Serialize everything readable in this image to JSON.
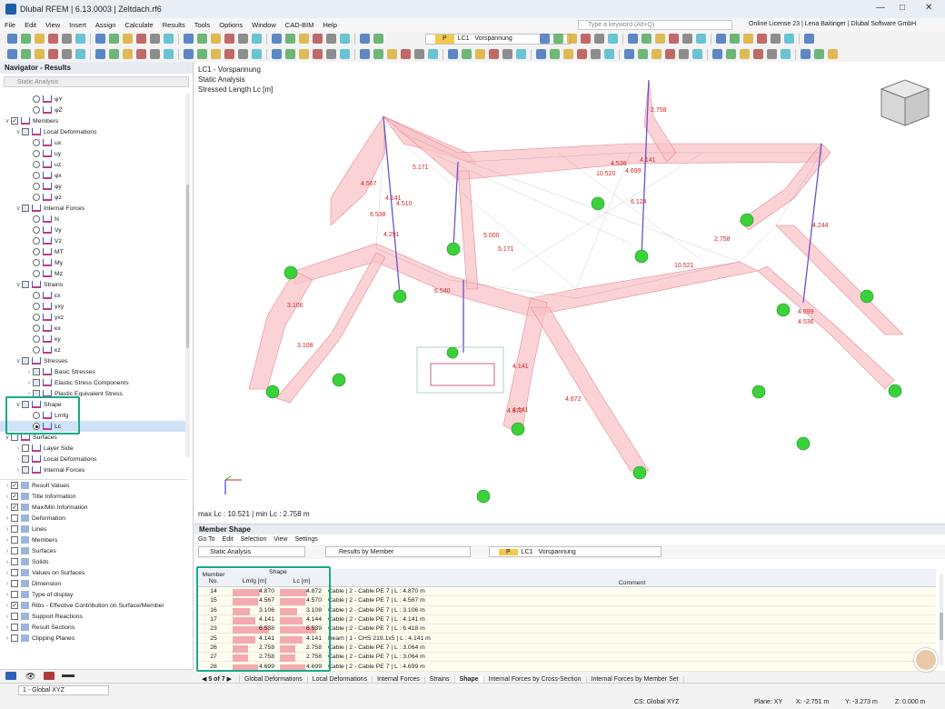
{
  "titlebar": {
    "title": "Dlubal RFEM | 6.13.0003 | Zeltdach.rf6"
  },
  "menu": [
    "File",
    "Edit",
    "View",
    "Insert",
    "Assign",
    "Calculate",
    "Results",
    "Tools",
    "Options",
    "Window",
    "CAD-BIM",
    "Help"
  ],
  "search": {
    "placeholder": "Type a keyword (Alt+Q)"
  },
  "license": "Online License 23 | Lena Baitinger | Dlubal Software GmbH",
  "toolbar": {
    "lc_tag": "P",
    "lc_id": "LC1",
    "lc_name": "Vorspannung"
  },
  "navigator": {
    "title": "Navigator - Results",
    "analysis": "Static Analysis",
    "items": [
      {
        "label": "φY",
        "level": 3,
        "ctl": "radio"
      },
      {
        "label": "φZ",
        "level": 3,
        "ctl": "radio"
      },
      {
        "label": "Members",
        "level": 1,
        "ctl": "check",
        "checked": true,
        "exp": "v"
      },
      {
        "label": "Local Deformations",
        "level": 2,
        "ctl": "box",
        "exp": "v"
      },
      {
        "label": "ux",
        "level": 3,
        "ctl": "radio"
      },
      {
        "label": "uy",
        "level": 3,
        "ctl": "radio"
      },
      {
        "label": "uz",
        "level": 3,
        "ctl": "radio"
      },
      {
        "label": "φx",
        "level": 3,
        "ctl": "radio"
      },
      {
        "label": "φy",
        "level": 3,
        "ctl": "radio"
      },
      {
        "label": "φz",
        "level": 3,
        "ctl": "radio"
      },
      {
        "label": "Internal Forces",
        "level": 2,
        "ctl": "box",
        "exp": "v"
      },
      {
        "label": "N",
        "level": 3,
        "ctl": "radio"
      },
      {
        "label": "Vy",
        "level": 3,
        "ctl": "radio"
      },
      {
        "label": "Vz",
        "level": 3,
        "ctl": "radio"
      },
      {
        "label": "MT",
        "level": 3,
        "ctl": "radio"
      },
      {
        "label": "My",
        "level": 3,
        "ctl": "radio"
      },
      {
        "label": "Mz",
        "level": 3,
        "ctl": "radio"
      },
      {
        "label": "Strains",
        "level": 2,
        "ctl": "box",
        "exp": "v"
      },
      {
        "label": "εx",
        "level": 3,
        "ctl": "radio"
      },
      {
        "label": "γxy",
        "level": 3,
        "ctl": "radio"
      },
      {
        "label": "γxz",
        "level": 3,
        "ctl": "radio"
      },
      {
        "label": "κx",
        "level": 3,
        "ctl": "radio"
      },
      {
        "label": "κy",
        "level": 3,
        "ctl": "radio"
      },
      {
        "label": "κz",
        "level": 3,
        "ctl": "radio"
      },
      {
        "label": "Stresses",
        "level": 2,
        "ctl": "box",
        "exp": "v"
      },
      {
        "label": "Basic Stresses",
        "level": 3,
        "ctl": "box",
        "exp": ">"
      },
      {
        "label": "Elastic Stress Components",
        "level": 3,
        "ctl": "box",
        "exp": ">"
      },
      {
        "label": "Plastic Equivalent Stress",
        "level": 3,
        "ctl": "box",
        "exp": ">"
      },
      {
        "label": "Shape",
        "level": 2,
        "ctl": "box",
        "exp": "v"
      },
      {
        "label": "Lmfg",
        "level": 3,
        "ctl": "radio"
      },
      {
        "label": "Lc",
        "level": 3,
        "ctl": "radio",
        "on": true,
        "sel": true
      },
      {
        "label": "Surfaces",
        "level": 1,
        "ctl": "check",
        "exp": "v"
      },
      {
        "label": "Layer Side",
        "level": 2,
        "ctl": "check",
        "exp": ">"
      },
      {
        "label": "Local Deformations",
        "level": 2,
        "ctl": "box",
        "exp": ">"
      },
      {
        "label": "Internal Forces",
        "level": 2,
        "ctl": "box",
        "exp": ">"
      }
    ],
    "options": [
      {
        "label": "Result Values",
        "checked": true
      },
      {
        "label": "Title Information",
        "checked": true
      },
      {
        "label": "Max/Min Information",
        "checked": true
      },
      {
        "label": "Deformation",
        "checked": false
      },
      {
        "label": "Lines",
        "checked": false
      },
      {
        "label": "Members",
        "checked": false
      },
      {
        "label": "Surfaces",
        "checked": false
      },
      {
        "label": "Solids",
        "checked": false
      },
      {
        "label": "Values on Surfaces",
        "checked": false
      },
      {
        "label": "Dimension",
        "checked": false
      },
      {
        "label": "Type of display",
        "checked": false
      },
      {
        "label": "Ribs - Effective Contribution on Surface/Member",
        "checked": true
      },
      {
        "label": "Support Reactions",
        "checked": false
      },
      {
        "label": "Result Sections",
        "checked": false
      },
      {
        "label": "Clipping Planes",
        "checked": false
      }
    ]
  },
  "graphics": {
    "line1": "LC1 - Vorspannung",
    "line2": "Static Analysis",
    "line3": "Stressed Length Lc [m]",
    "maxmin": "max Lc : 10.521 | min Lc : 2.758 m",
    "labels": [
      "2.758",
      "4.141",
      "4.536",
      "4.699",
      "10.520",
      "5.171",
      "4.567",
      "4.141",
      "4.510",
      "6.538",
      "4.291",
      "5.000",
      "5.171",
      "6.124",
      "4.244",
      "2.758",
      "10.521",
      "6.540",
      "3.106",
      "3.108",
      "4.699",
      "4.536",
      "4.141",
      "4.141",
      "4.870",
      "4.872"
    ]
  },
  "member_shape": {
    "title": "Member Shape",
    "menu": [
      "Go To",
      "Edit",
      "Selection",
      "View",
      "Settings"
    ],
    "analysis": "Static Analysis",
    "results_by": "Results by Member",
    "lc_tag": "P",
    "lc_id": "LC1",
    "lc_name": "Vorspannung",
    "headers": {
      "member": "Member",
      "no": "No.",
      "shape": "Shape",
      "lmfg": "Lmfg [m]",
      "lc": "Lc [m]",
      "comment": "Comment"
    },
    "rows": [
      {
        "no": "14",
        "lmfg": "4.870",
        "lc": "4.872",
        "comment": "Cable | 2 - Cable PE 7 | L : 4.870 m"
      },
      {
        "no": "15",
        "lmfg": "4.567",
        "lc": "4.570",
        "comment": "Cable | 2 - Cable PE 7 | L : 4.567 m"
      },
      {
        "no": "16",
        "lmfg": "3.106",
        "lc": "3.108",
        "comment": "Cable | 2 - Cable PE 7 | L : 3.106 m"
      },
      {
        "no": "17",
        "lmfg": "4.141",
        "lc": "4.144",
        "comment": "Cable | 2 - Cable PE 7 | L : 4.141 m"
      },
      {
        "no": "23",
        "lmfg": "6.538",
        "lc": "6.539",
        "comment": "Cable | 2 - Cable PE 7 | L : 6.418 m"
      },
      {
        "no": "25",
        "lmfg": "4.141",
        "lc": "4.141",
        "comment": "Beam | 1 - CHS 219.1x5 | L : 4.141 m"
      },
      {
        "no": "26",
        "lmfg": "2.758",
        "lc": "2.758",
        "comment": "Cable | 2 - Cable PE 7 | L : 3.064 m"
      },
      {
        "no": "27",
        "lmfg": "2.758",
        "lc": "2.758",
        "comment": "Cable | 2 - Cable PE 7 | L : 3.064 m"
      },
      {
        "no": "28",
        "lmfg": "4.699",
        "lc": "4.699",
        "comment": "Cable | 2 - Cable PE 7 | L : 4.699 m"
      }
    ],
    "pager": "5 of 7",
    "tabs": [
      "Global Deformations",
      "Local Deformations",
      "Internal Forces",
      "Strains",
      "Shape",
      "Internal Forces by Cross-Section",
      "Internal Forces by Member Set"
    ],
    "active_tab": "Shape"
  },
  "status": {
    "cs": "CS: Global XYZ",
    "plane": "Plane: XY",
    "x": "X: -2.751 m",
    "y": "Y: -3.273 m",
    "z": "Z: 0.000 m",
    "view": "1 - Global XYZ"
  }
}
